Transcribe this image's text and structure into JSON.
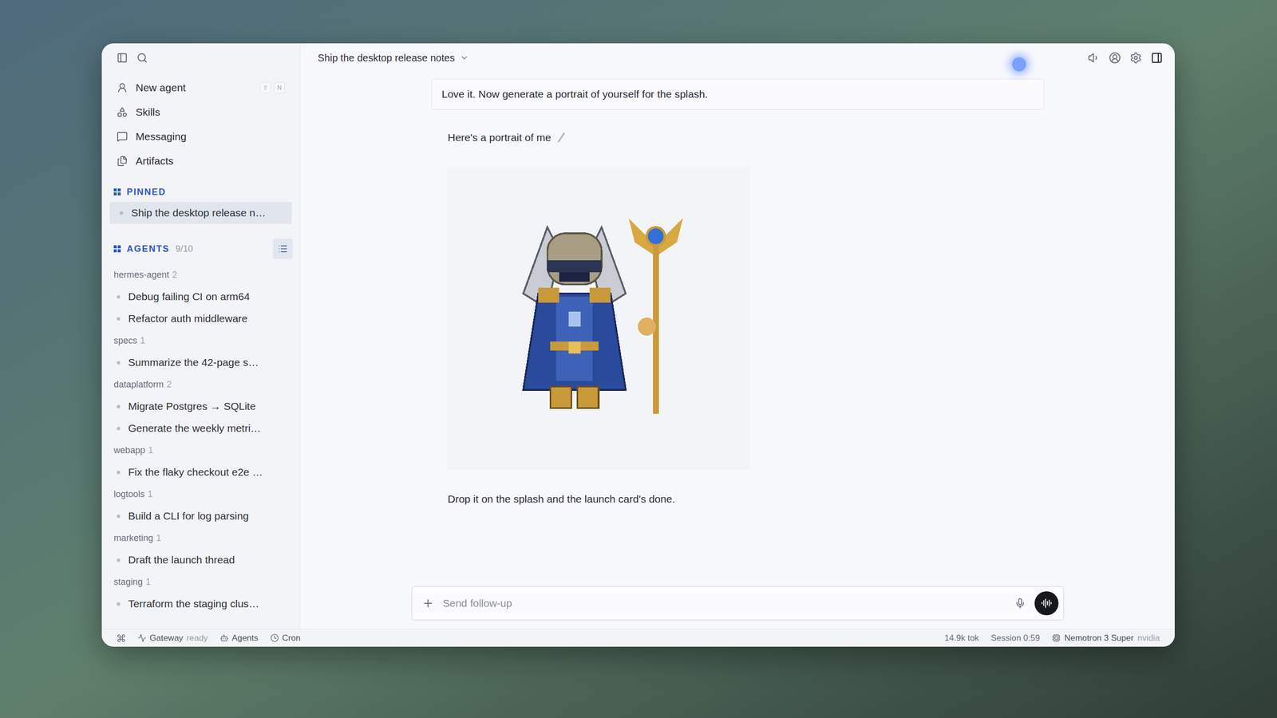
{
  "window": {
    "title": "Ship the desktop release notes"
  },
  "sidebar": {
    "nav": [
      {
        "label": "New agent",
        "shortcut": [
          "⇧",
          "N"
        ]
      },
      {
        "label": "Skills",
        "shortcut": []
      },
      {
        "label": "Messaging",
        "shortcut": []
      },
      {
        "label": "Artifacts",
        "shortcut": []
      }
    ],
    "pinned": {
      "heading": "PINNED",
      "items": [
        {
          "label": "Ship the desktop release n…",
          "selected": true
        }
      ]
    },
    "agents": {
      "heading": "AGENTS",
      "count": "9/10",
      "groups": [
        {
          "name": "hermes-agent",
          "count": "2",
          "items": [
            {
              "label": "Debug failing CI on arm64",
              "selected": false
            },
            {
              "label": "Refactor auth middleware",
              "selected": false
            }
          ]
        },
        {
          "name": "specs",
          "count": "1",
          "items": [
            {
              "label": "Summarize the 42-page s…",
              "selected": false
            }
          ]
        },
        {
          "name": "dataplatform",
          "count": "2",
          "items": [
            {
              "label": "Migrate Postgres → SQLite",
              "selected": false
            },
            {
              "label": "Generate the weekly metri…",
              "selected": false
            }
          ]
        },
        {
          "name": "webapp",
          "count": "1",
          "items": [
            {
              "label": "Fix the flaky checkout e2e …",
              "selected": false
            }
          ]
        },
        {
          "name": "logtools",
          "count": "1",
          "items": [
            {
              "label": "Build a CLI for log parsing",
              "selected": false
            }
          ]
        },
        {
          "name": "marketing",
          "count": "1",
          "items": [
            {
              "label": "Draft the launch thread",
              "selected": false
            }
          ]
        },
        {
          "name": "staging",
          "count": "1",
          "items": [
            {
              "label": "Terraform the staging clus…",
              "selected": false
            }
          ]
        }
      ]
    }
  },
  "conversation": {
    "user_message": "Love it. Now generate a portrait of yourself for the splash.",
    "reply_intro": "Here's a portrait of me",
    "reply_outro": "Drop it on the splash and the launch card's done."
  },
  "composer": {
    "placeholder": "Send follow-up"
  },
  "status_bar": {
    "left": [
      {
        "kind": "gateway",
        "label": "Gateway",
        "detail": "ready"
      },
      {
        "kind": "agents",
        "label": "Agents",
        "detail": ""
      },
      {
        "kind": "cron",
        "label": "Cron",
        "detail": ""
      }
    ],
    "tokens": "14.9k tok",
    "session": "Session 0:59",
    "model": "Nemotron 3 Super",
    "provider": "nvidia"
  }
}
